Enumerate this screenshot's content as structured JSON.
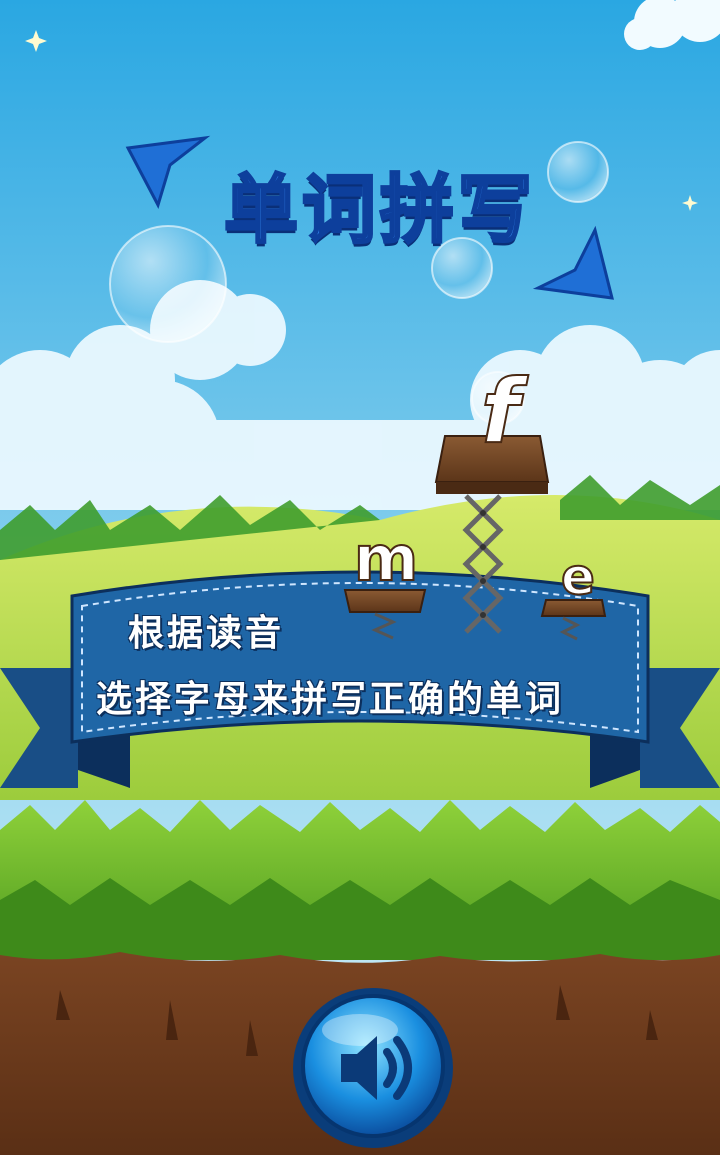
{
  "title": "单词拼写",
  "instructions": {
    "line1": "根据读音",
    "line2": "选择字母来拼写正确的单词"
  },
  "letter_tiles": [
    {
      "letter": "m",
      "role": "left-platform-letter"
    },
    {
      "letter": "f",
      "role": "lifted-platform-letter"
    },
    {
      "letter": "e",
      "role": "right-platform-letter"
    }
  ],
  "sound_button": {
    "icon": "speaker-icon"
  },
  "colors": {
    "sky_top": "#3fb3e6",
    "sky_bottom": "#bfe8f5",
    "banner": "#1f66a6",
    "title_blue": "#2f7fe6",
    "grass": "#69b52a",
    "soil": "#6b3a1c"
  }
}
